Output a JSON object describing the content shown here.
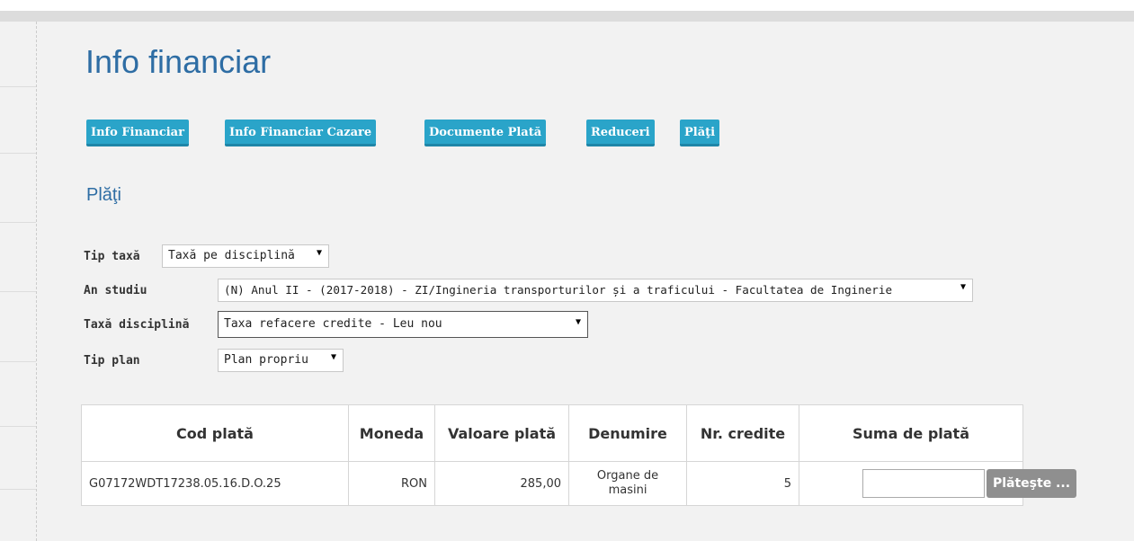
{
  "page": {
    "title": "Info financiar",
    "section_title": "Plăţi"
  },
  "tabs": [
    {
      "label": "Info Financiar"
    },
    {
      "label": "Info Financiar Cazare"
    },
    {
      "label": "Documente Plată"
    },
    {
      "label": "Reduceri"
    },
    {
      "label": "Plăţi"
    }
  ],
  "form": {
    "tip_taxa": {
      "label": "Tip taxă",
      "value": "Taxă pe disciplină"
    },
    "an_studiu": {
      "label": "An studiu",
      "value": "(N) Anul II - (2017-2018) - ZI/Ingineria transporturilor și a traficului - Facultatea de Inginerie"
    },
    "taxa_disciplina": {
      "label": "Taxă disciplină",
      "value": "Taxa refacere credite - Leu nou"
    },
    "tip_plan": {
      "label": "Tip plan",
      "value": "Plan propriu"
    }
  },
  "table": {
    "headers": [
      "Cod plată",
      "Moneda",
      "Valoare plată",
      "Denumire",
      "Nr. credite",
      "Suma de plată"
    ],
    "rows": [
      {
        "cod": "G07172WDT17238.05.16.D.O.25",
        "moneda": "RON",
        "valoare": "285,00",
        "denumire": "Organe de masini",
        "credite": "5",
        "suma": ""
      }
    ],
    "pay_button": "Plăteşte ..."
  },
  "icons": {
    "dropdown": "dropdown-arrow-icon"
  },
  "colors": {
    "accent": "#2aa4c9",
    "title": "#2e6da4",
    "pay_button": "#8f8f8f"
  }
}
